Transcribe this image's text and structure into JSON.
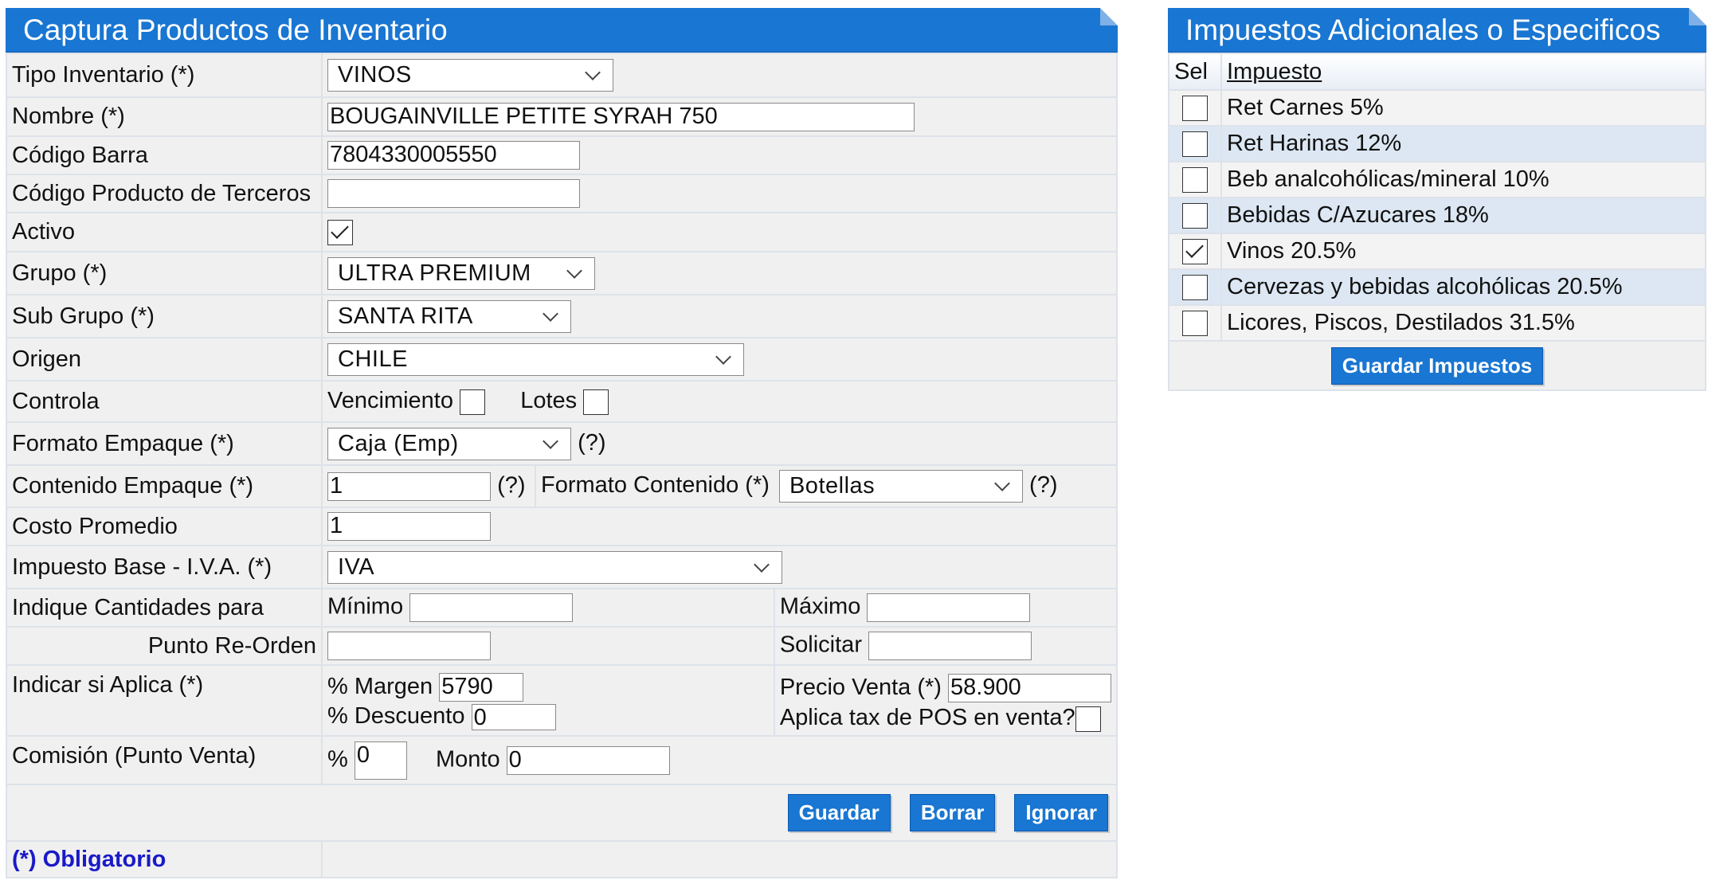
{
  "left_panel": {
    "title": "Captura Productos de Inventario",
    "rows": {
      "tipo_inventario": {
        "label": "Tipo Inventario (*)",
        "value": "VINOS"
      },
      "nombre": {
        "label": "Nombre (*)",
        "value": "BOUGAINVILLE PETITE SYRAH 750"
      },
      "codigo_barra": {
        "label": "Código Barra",
        "value": "7804330005550"
      },
      "codigo_terceros": {
        "label": "Código Producto de Terceros",
        "value": ""
      },
      "activo": {
        "label": "Activo",
        "checked": true
      },
      "grupo": {
        "label": "Grupo (*)",
        "value": "ULTRA PREMIUM"
      },
      "sub_grupo": {
        "label": "Sub Grupo (*)",
        "value": "SANTA RITA"
      },
      "origen": {
        "label": "Origen",
        "value": "CHILE"
      },
      "controla": {
        "label": "Controla",
        "vencimiento": "Vencimiento",
        "lotes": "Lotes"
      },
      "formato_empaque": {
        "label": "Formato Empaque (*)",
        "value": "Caja (Emp)",
        "help": "(?)"
      },
      "contenido_empaque": {
        "label": "Contenido Empaque (*)",
        "value": "1",
        "help": "(?)",
        "formato_label": "Formato Contenido (*)",
        "formato_value": "Botellas",
        "formato_help": "(?)"
      },
      "costo_promedio": {
        "label": "Costo Promedio",
        "value": "1"
      },
      "impuesto_base": {
        "label": "Impuesto Base - I.V.A. (*)",
        "value": "IVA"
      },
      "cantidades": {
        "label": "Indique Cantidades para",
        "minimo": "Mínimo",
        "maximo": "Máximo"
      },
      "reorden": {
        "label": "Punto Re-Orden",
        "solicitar": "Solicitar"
      },
      "aplica": {
        "label": "Indicar si Aplica (*)",
        "margen_label": "% Margen",
        "margen_value": "5790",
        "descuento_label": "% Descuento",
        "descuento_value": "0",
        "precio_label": "Precio Venta (*)",
        "precio_value": "58.900",
        "tax_label": "Aplica tax de POS en venta?"
      },
      "comision": {
        "label": "Comisión (Punto Venta)",
        "pct_label": "%",
        "pct_value": "0",
        "monto_label": "Monto",
        "monto_value": "0"
      }
    },
    "buttons": {
      "guardar": "Guardar",
      "borrar": "Borrar",
      "ignorar": "Ignorar"
    },
    "footer_note": "(*) Obligatorio"
  },
  "right_panel": {
    "title": "Impuestos Adicionales o Especificos",
    "col_sel": "Sel",
    "col_impuesto": "Impuesto",
    "taxes": [
      {
        "name": "Ret Carnes 5%",
        "checked": false
      },
      {
        "name": "Ret Harinas 12%",
        "checked": false
      },
      {
        "name": "Beb analcohólicas/mineral 10%",
        "checked": false
      },
      {
        "name": "Bebidas C/Azucares 18%",
        "checked": false
      },
      {
        "name": "Vinos 20.5%",
        "checked": true
      },
      {
        "name": "Cervezas y bebidas alcohólicas 20.5%",
        "checked": false
      },
      {
        "name": "Licores, Piscos, Destilados 31.5%",
        "checked": false
      }
    ],
    "save_button": "Guardar Impuestos"
  },
  "colors": {
    "header_blue": "#1976d2",
    "row_alt": "#dce7f3",
    "required_text": "#1a1ac8"
  }
}
